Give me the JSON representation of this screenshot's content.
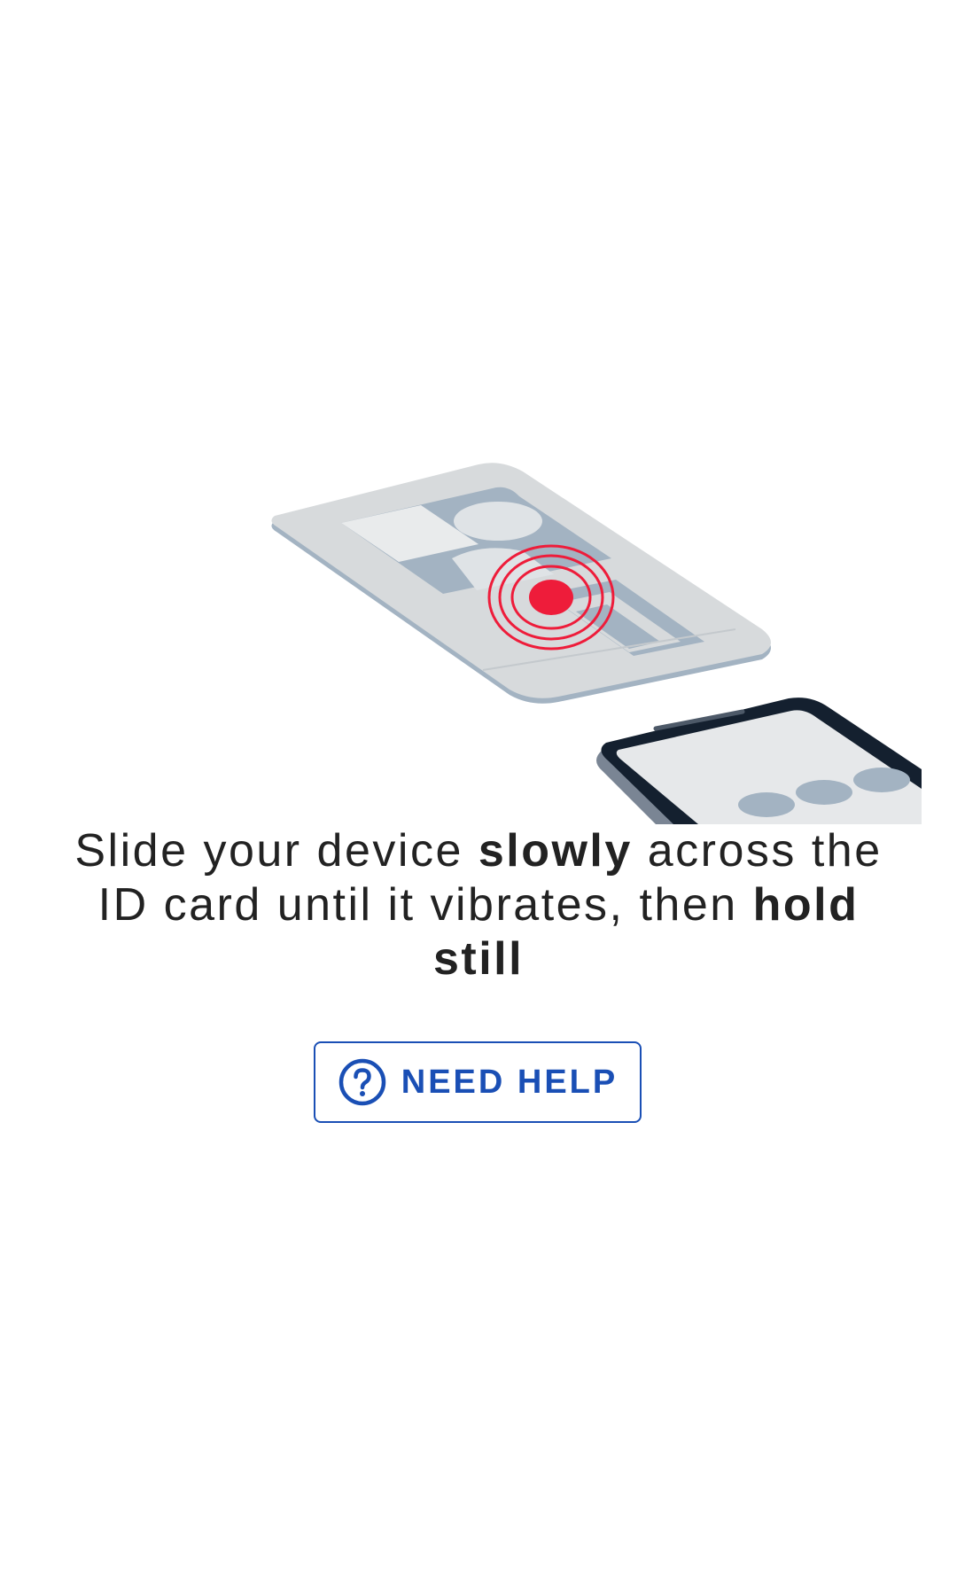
{
  "instruction": {
    "part1": "Slide your device ",
    "bold1": "slowly",
    "part2": " across the ID card until it vibrates, then ",
    "bold2": "hold still"
  },
  "help_button": {
    "label": "NEED HELP",
    "icon": "help-circle-icon"
  },
  "illustration": {
    "card_icon": "id-card-illustration",
    "phone_icon": "phone-illustration",
    "target_icon": "nfc-target-icon"
  },
  "colors": {
    "accent": "#1a4fb5",
    "target_red": "#ee1c3a",
    "card_gray": "#d7dadc",
    "card_blue_gray": "#a3b3c2",
    "phone_dark": "#14202f",
    "text": "#222222"
  }
}
